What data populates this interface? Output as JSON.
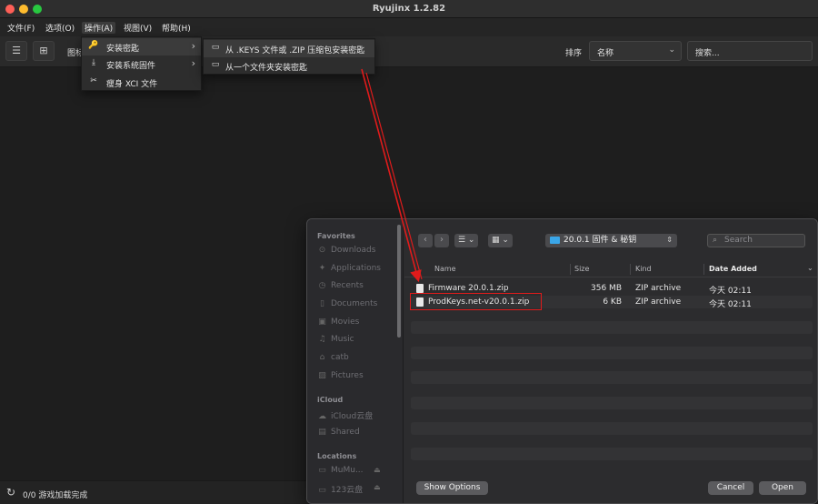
{
  "window": {
    "title": "Ryujinx 1.2.82"
  },
  "menubar": [
    {
      "label": "文件(F)"
    },
    {
      "label": "选项(O)"
    },
    {
      "label": "操作(A)"
    },
    {
      "label": "视图(V)"
    },
    {
      "label": "帮助(H)"
    }
  ],
  "toolbar": {
    "view_label": "图标",
    "sort_label": "排序",
    "sort_value": "名称",
    "search_placeholder": "搜索..."
  },
  "actions_menu": {
    "items": [
      {
        "icon": "key-icon",
        "label": "安装密匙"
      },
      {
        "icon": "download-icon",
        "label": "安装系统固件"
      },
      {
        "icon": "scissors-icon",
        "label": "瘦身 XCI 文件"
      }
    ],
    "submenu": [
      {
        "label": "从 .KEYS 文件或 .ZIP 压缩包安装密匙"
      },
      {
        "label": "从一个文件夹安装密匙"
      }
    ]
  },
  "status": {
    "text": "0/0 游戏加载完成"
  },
  "dialog": {
    "location": "20.0.1 固件 & 秘钥",
    "search_placeholder": "Search",
    "sidebar": {
      "favorites_header": "Favorites",
      "favorites": [
        "Downloads",
        "Applications",
        "Recents",
        "Documents",
        "Movies",
        "Music",
        "catb",
        "Pictures"
      ],
      "icloud_header": "iCloud",
      "icloud": [
        "iCloud云盘",
        "Shared"
      ],
      "locations_header": "Locations",
      "locations": [
        "MuMu...",
        "123云盘"
      ]
    },
    "columns": {
      "name": "Name",
      "size": "Size",
      "kind": "Kind",
      "date": "Date Added"
    },
    "files": [
      {
        "name": "Firmware 20.0.1.zip",
        "size": "356 MB",
        "kind": "ZIP archive",
        "date": "今天 02:11"
      },
      {
        "name": "ProdKeys.net-v20.0.1.zip",
        "size": "6 KB",
        "kind": "ZIP archive",
        "date": "今天 02:11"
      }
    ],
    "buttons": {
      "options": "Show Options",
      "cancel": "Cancel",
      "open": "Open"
    }
  },
  "colors": {
    "annotation_red": "#e01b1b",
    "folder_blue": "#3aa6e8"
  }
}
